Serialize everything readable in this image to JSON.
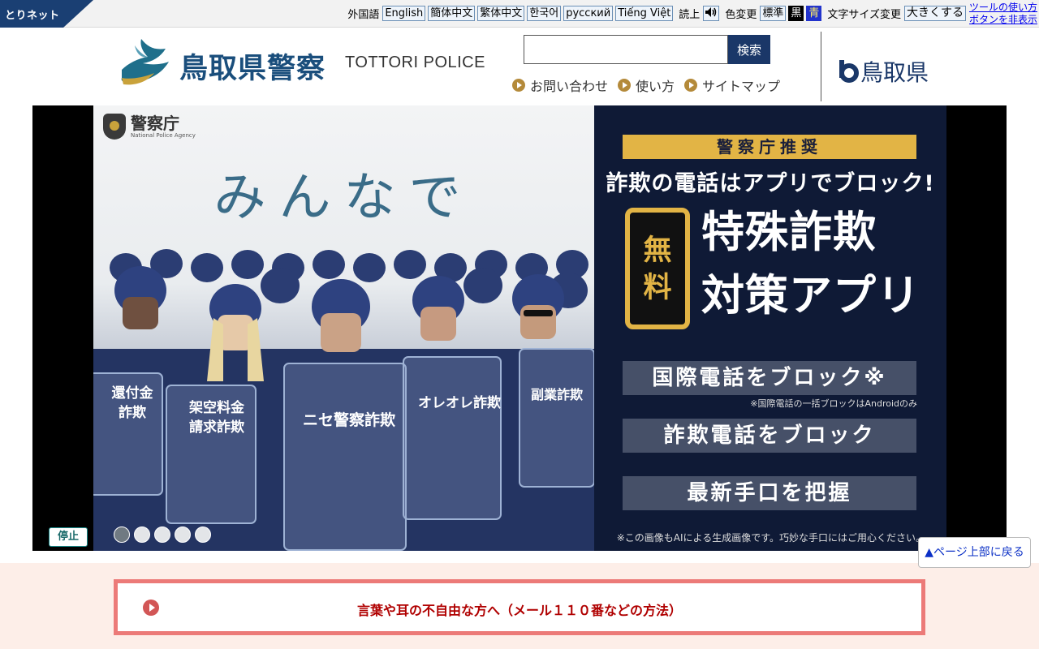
{
  "toolbar": {
    "torinet_label": "とりネット",
    "foreign_label": "外国語",
    "languages": [
      "English",
      "簡体中文",
      "繁体中文",
      "한국어",
      "русский",
      "Tiếng Việt"
    ],
    "read_label": "読上",
    "speaker_icon": "speaker-icon",
    "color_label": "色変更",
    "color_standard": "標準",
    "color_black": "黒",
    "color_blue": "青",
    "fontsize_label": "文字サイズ変更",
    "bigger_label": "大きくする",
    "help_link": "ツールの使い方",
    "hide_link": "ボタンを非表示"
  },
  "header": {
    "site_title_jp": "鳥取県警察",
    "site_title_en": "TOTTORI POLICE",
    "search_button": "検索",
    "nav": [
      "お問い合わせ",
      "使い方",
      "サイトマップ"
    ],
    "pref_name": "鳥取県",
    "colors": {
      "brand": "#1a4e7c",
      "nav_bullet": "#b48a3a",
      "search_button": "#1a3768"
    }
  },
  "banner": {
    "agency_jp": "警察庁",
    "agency_en": "National Police Agency",
    "left_headline": "みんなで",
    "shields": [
      "還付金詐欺",
      "架空料金請求詐欺",
      "ニセ警察詐欺",
      "オレオレ詐欺",
      "副業詐欺"
    ],
    "recommend": "警察庁推奨",
    "headline": "詐欺の電話はアプリでブロック!",
    "free": "無料",
    "app_title_line1": "特殊詐欺",
    "app_title_line2": "対策アプリ",
    "features": [
      "国際電話をブロック※",
      "詐欺電話をブロック",
      "最新手口を把握"
    ],
    "feature_note": "※国際電話の一括ブロックはAndroidのみ",
    "disclaimer": "※この画像もAIによる生成画像です。巧妙な手口にはご用心ください。",
    "stop_label": "停止",
    "slide_count": 5,
    "active_slide": 1
  },
  "pagetop": {
    "label": "▲ページ上部に戻る"
  },
  "notice": {
    "text": "言葉や耳の不自由な方へ（メール１１０番などの方法）"
  }
}
